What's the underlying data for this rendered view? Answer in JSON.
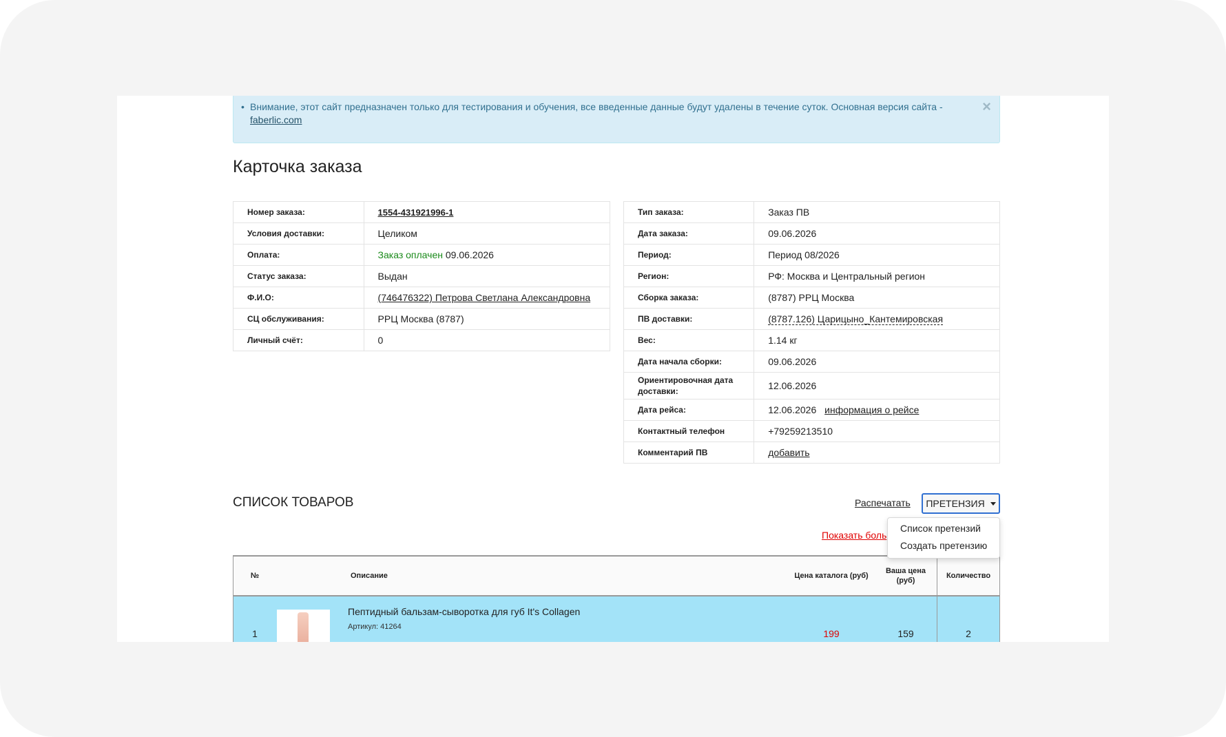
{
  "alert": {
    "bullet": "•",
    "text": "Внимание, этот сайт предназначен только для тестирования и обучения, все введенные данные будут удалены в течение суток. Основная версия сайта -",
    "link": "faberlic.com",
    "close": "×"
  },
  "page_title": "Карточка заказа",
  "left_info": [
    {
      "label": "Номер заказа:",
      "value": "1554-431921996-1"
    },
    {
      "label": "Условия доставки:",
      "value": "Целиком"
    },
    {
      "label": "Оплата:",
      "status": "Заказ оплачен",
      "value": "09.06.2026"
    },
    {
      "label": "Статус заказа:",
      "value": "Выдан"
    },
    {
      "label": "Ф.И.О:",
      "value": "(746476322) Петрова Светлана Александровна"
    },
    {
      "label": "СЦ обслуживания:",
      "value": "РРЦ Москва (8787)"
    },
    {
      "label": "Личный счёт:",
      "value": "0"
    }
  ],
  "right_info": [
    {
      "label": "Тип заказа:",
      "value": "Заказ ПВ"
    },
    {
      "label": "Дата заказа:",
      "value": "09.06.2026"
    },
    {
      "label": "Период:",
      "value": "Период 08/2026"
    },
    {
      "label": "Регион:",
      "value": "РФ: Москва и Центральный регион"
    },
    {
      "label": "Сборка заказа:",
      "value": "(8787) РРЦ Москва"
    },
    {
      "label": "ПВ доставки:",
      "value": "(8787.126) Царицыно_Кантемировская"
    },
    {
      "label": "Вес:",
      "value": "1.14 кг"
    },
    {
      "label": "Дата начала сборки:",
      "value": "09.06.2026"
    },
    {
      "label": "Ориентировочная дата доставки:",
      "value": "12.06.2026"
    },
    {
      "label": "Дата рейса:",
      "value": "12.06.2026",
      "link": "информация о рейсе"
    },
    {
      "label": "Контактный телефон",
      "value": "+79259213510"
    },
    {
      "label": "Комментарий ПВ",
      "value": "добавить"
    }
  ],
  "products": {
    "title": "СПИСОК ТОВАРОВ",
    "print": "Распечатать",
    "claim_button": "ПРЕТЕНЗИЯ",
    "show_more": "Показать боль",
    "dropdown": [
      "Список претензий",
      "Создать претензию"
    ],
    "columns": {
      "num": "№",
      "desc": "Описание",
      "catalog_price": "Цена каталога (руб)",
      "your_price": "Ваша цена (руб)",
      "qty": "Количество"
    },
    "rows": [
      {
        "num": "1",
        "name": "Пептидный бальзам-сыворотка для губ It's Collagen",
        "sku": "Артикул: 41264",
        "catalog_price": "199",
        "your_price": "159",
        "qty": "2"
      }
    ]
  },
  "colors": {
    "alert_bg": "#d9edf7",
    "paid_green": "#1a8a1a",
    "catalog_price_red": "#e00000",
    "row_highlight": "#a3e3f8",
    "claim_border": "#2f6fd1"
  }
}
